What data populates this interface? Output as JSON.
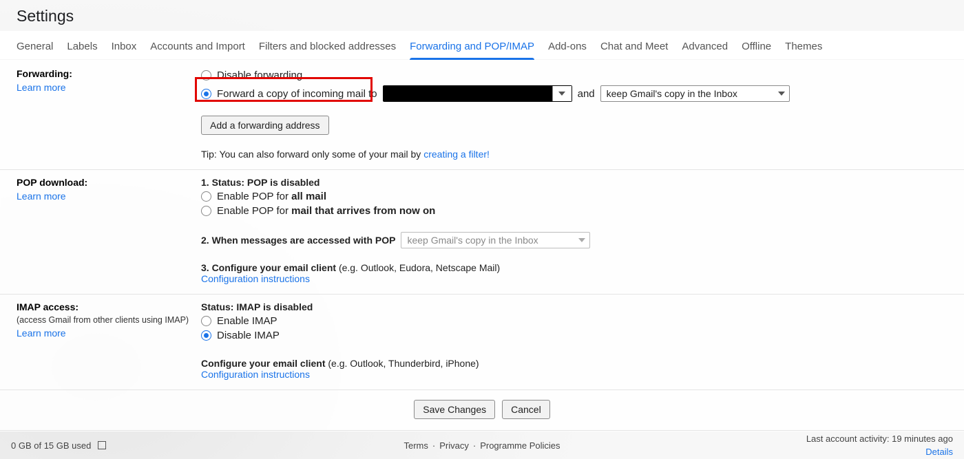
{
  "pageTitle": "Settings",
  "tabs": [
    {
      "label": "General"
    },
    {
      "label": "Labels"
    },
    {
      "label": "Inbox"
    },
    {
      "label": "Accounts and Import"
    },
    {
      "label": "Filters and blocked addresses"
    },
    {
      "label": "Forwarding and POP/IMAP",
      "active": true
    },
    {
      "label": "Add-ons"
    },
    {
      "label": "Chat and Meet"
    },
    {
      "label": "Advanced"
    },
    {
      "label": "Offline"
    },
    {
      "label": "Themes"
    }
  ],
  "forwarding": {
    "title": "Forwarding:",
    "learnMore": "Learn more",
    "disableLabel": "Disable forwarding",
    "forwardLabelPrefix": "Forward a copy of incoming mail to",
    "and": "and",
    "keepCopy": "keep Gmail's copy in the Inbox",
    "addBtn": "Add a forwarding address",
    "tipPrefix": "Tip: You can also forward only some of your mail by ",
    "tipLink": "creating a filter!"
  },
  "pop": {
    "title": "POP download:",
    "learnMore": "Learn more",
    "statusTitle": "1. Status: ",
    "statusValue": "POP is disabled",
    "enableAllPrefix": "Enable POP for ",
    "enableAllBold": "all mail",
    "enableNowPrefix": "Enable POP for ",
    "enableNowBold": "mail that arrives from now on",
    "whenAccessed": "2. When messages are accessed with POP",
    "popAction": "keep Gmail's copy in the Inbox",
    "configurePrefix": "3. Configure your email client ",
    "configureHint": "(e.g. Outlook, Eudora, Netscape Mail)",
    "configLink": "Configuration instructions"
  },
  "imap": {
    "title": "IMAP access:",
    "sub": "(access Gmail from other clients using IMAP)",
    "learnMore": "Learn more",
    "statusPrefix": "Status: ",
    "statusValue": "IMAP is disabled",
    "enable": "Enable IMAP",
    "disable": "Disable IMAP",
    "configurePrefix": "Configure your email client ",
    "configureHint": "(e.g. Outlook, Thunderbird, iPhone)",
    "configLink": "Configuration instructions"
  },
  "actions": {
    "save": "Save Changes",
    "cancel": "Cancel"
  },
  "footer": {
    "storage": "0 GB of 15 GB used",
    "terms": "Terms",
    "privacy": "Privacy",
    "policies": "Programme Policies",
    "activity": "Last account activity: 19 minutes ago",
    "details": "Details"
  }
}
